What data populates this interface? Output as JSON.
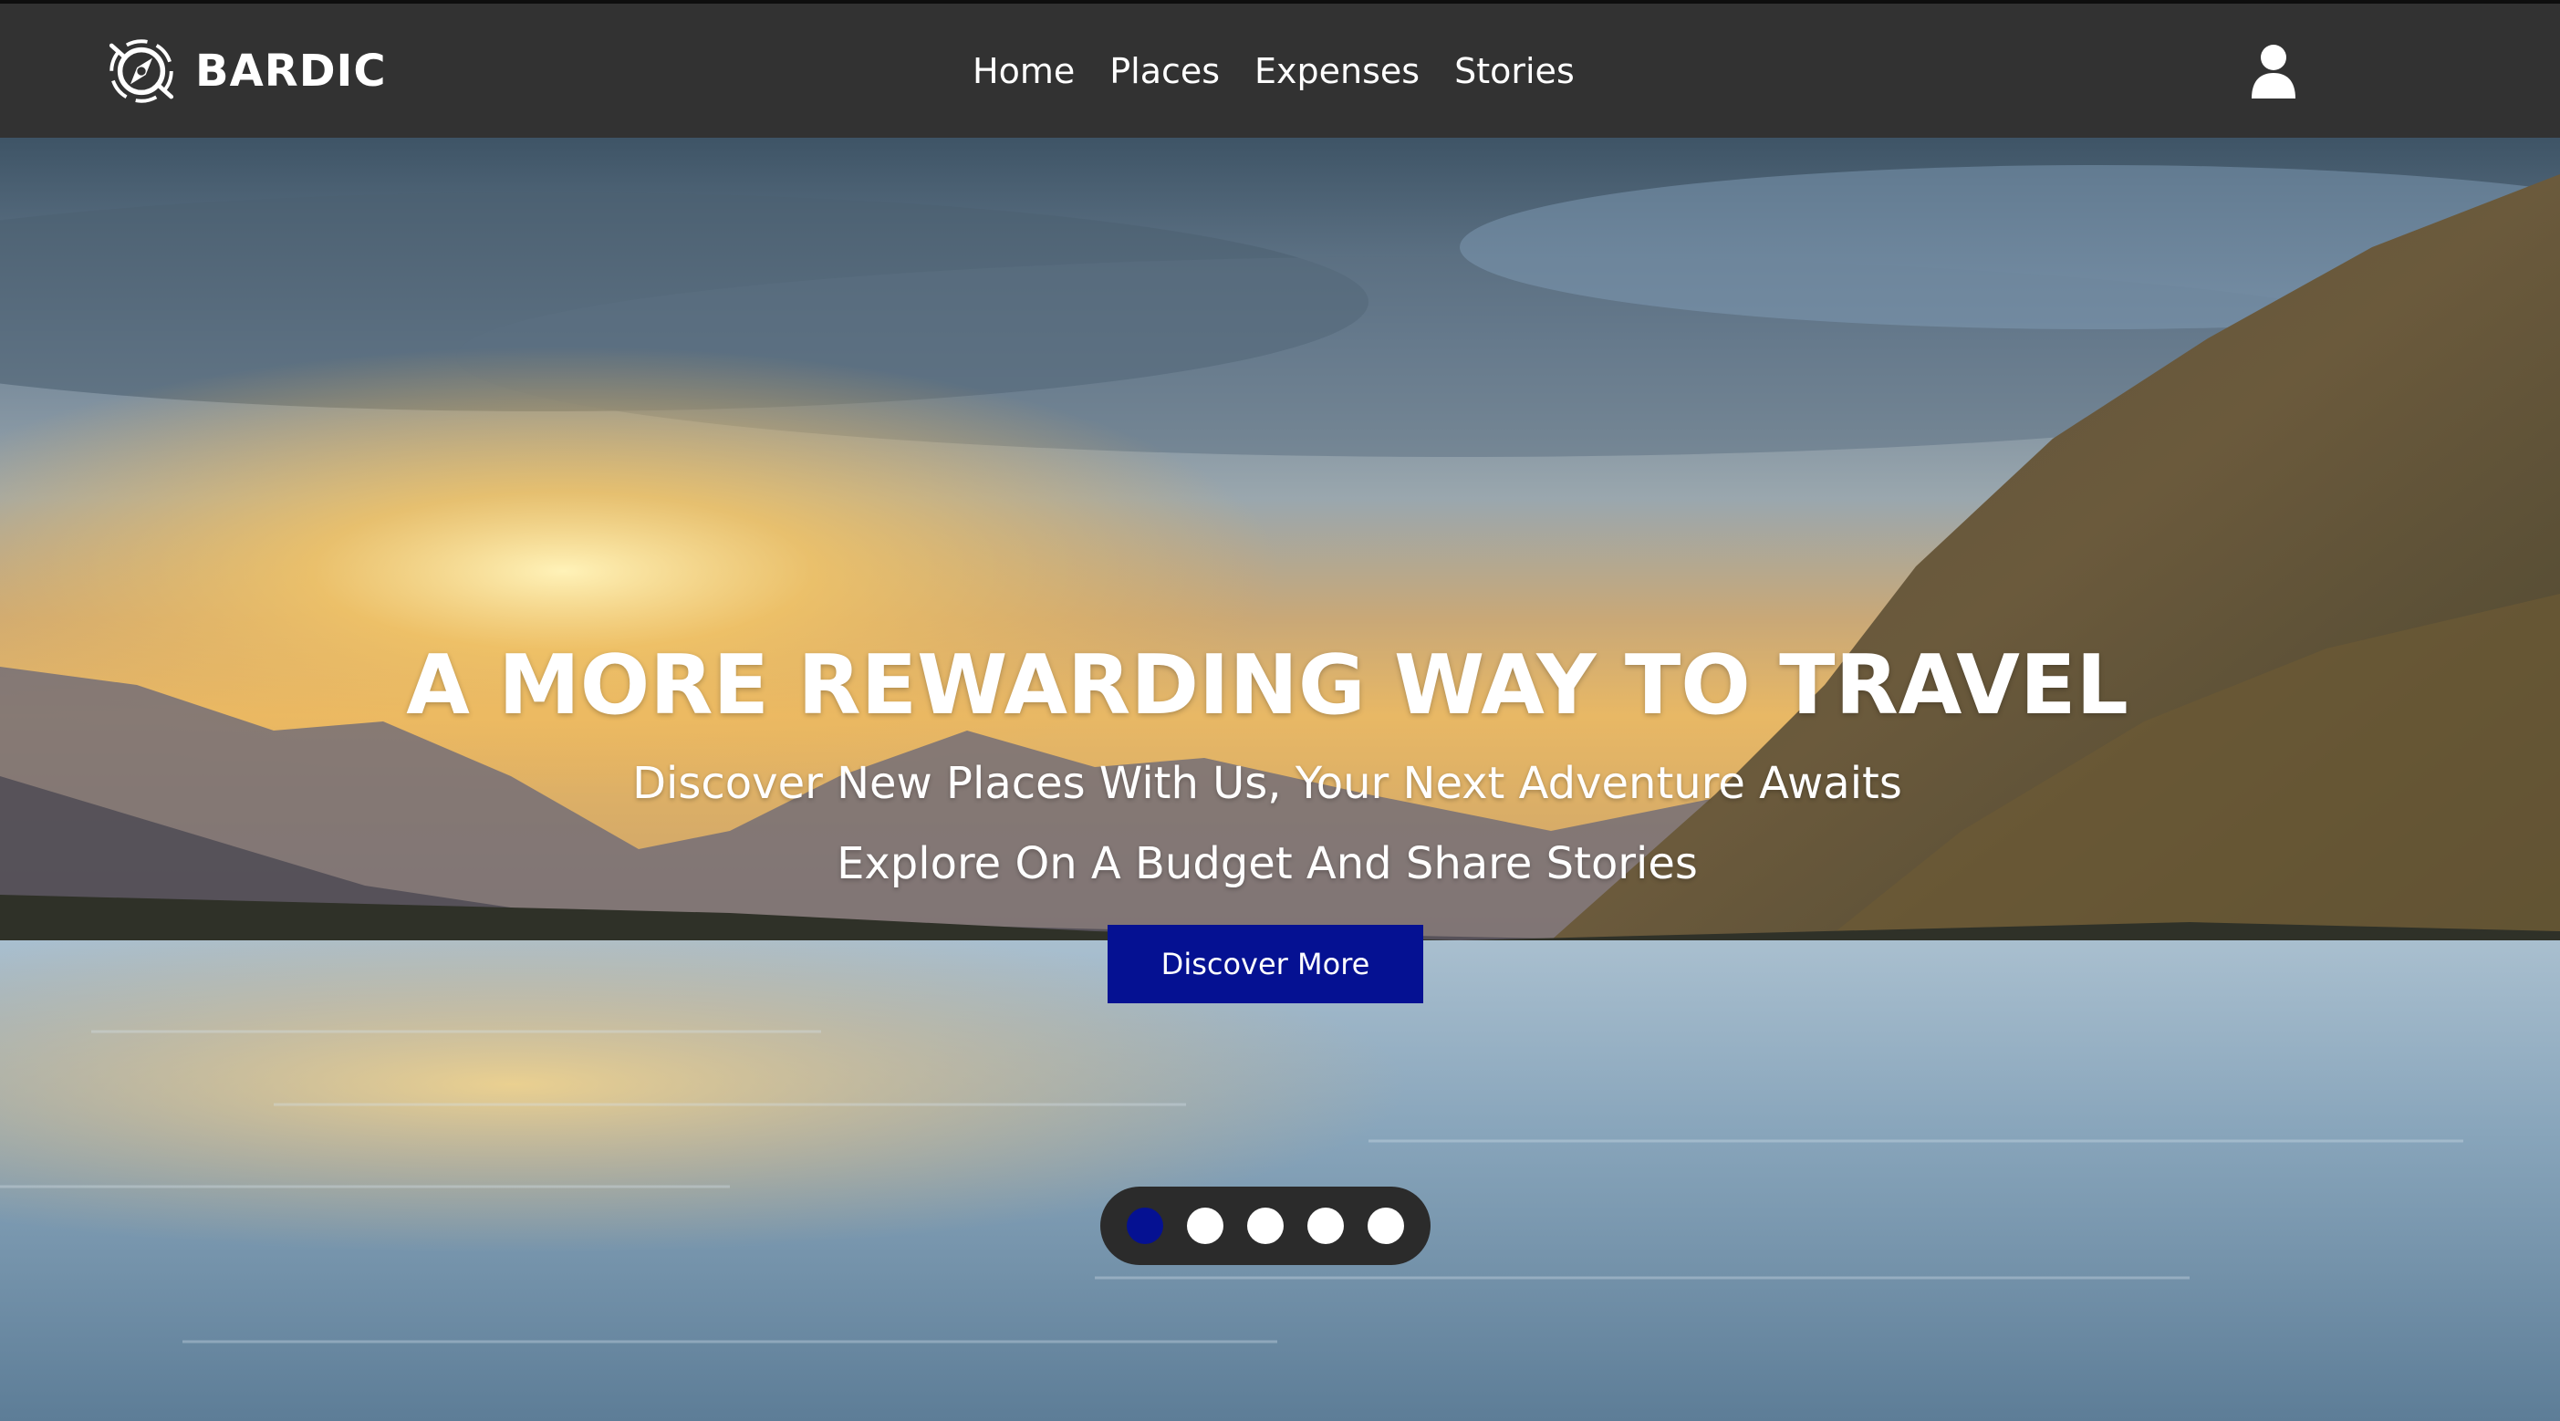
{
  "header": {
    "brand": "BARDIC",
    "nav": [
      {
        "label": "Home"
      },
      {
        "label": "Places"
      },
      {
        "label": "Expenses"
      },
      {
        "label": "Stories"
      }
    ],
    "user_icon": "user-icon",
    "logo_icon": "compass-icon"
  },
  "hero": {
    "title": "A MORE REWARDING WAY TO TRAVEL",
    "subtitle_1": "Discover New Places With Us, Your Next Adventure Awaits",
    "subtitle_2": "Explore On A Budget And Share Stories",
    "cta_label": "Discover More",
    "carousel": {
      "slide_count": 5,
      "active_index": 0
    }
  },
  "colors": {
    "navbar": "#323232",
    "accent": "#051192",
    "dot_inactive": "#ffffff",
    "dots_bg": "#2b2b2b"
  }
}
